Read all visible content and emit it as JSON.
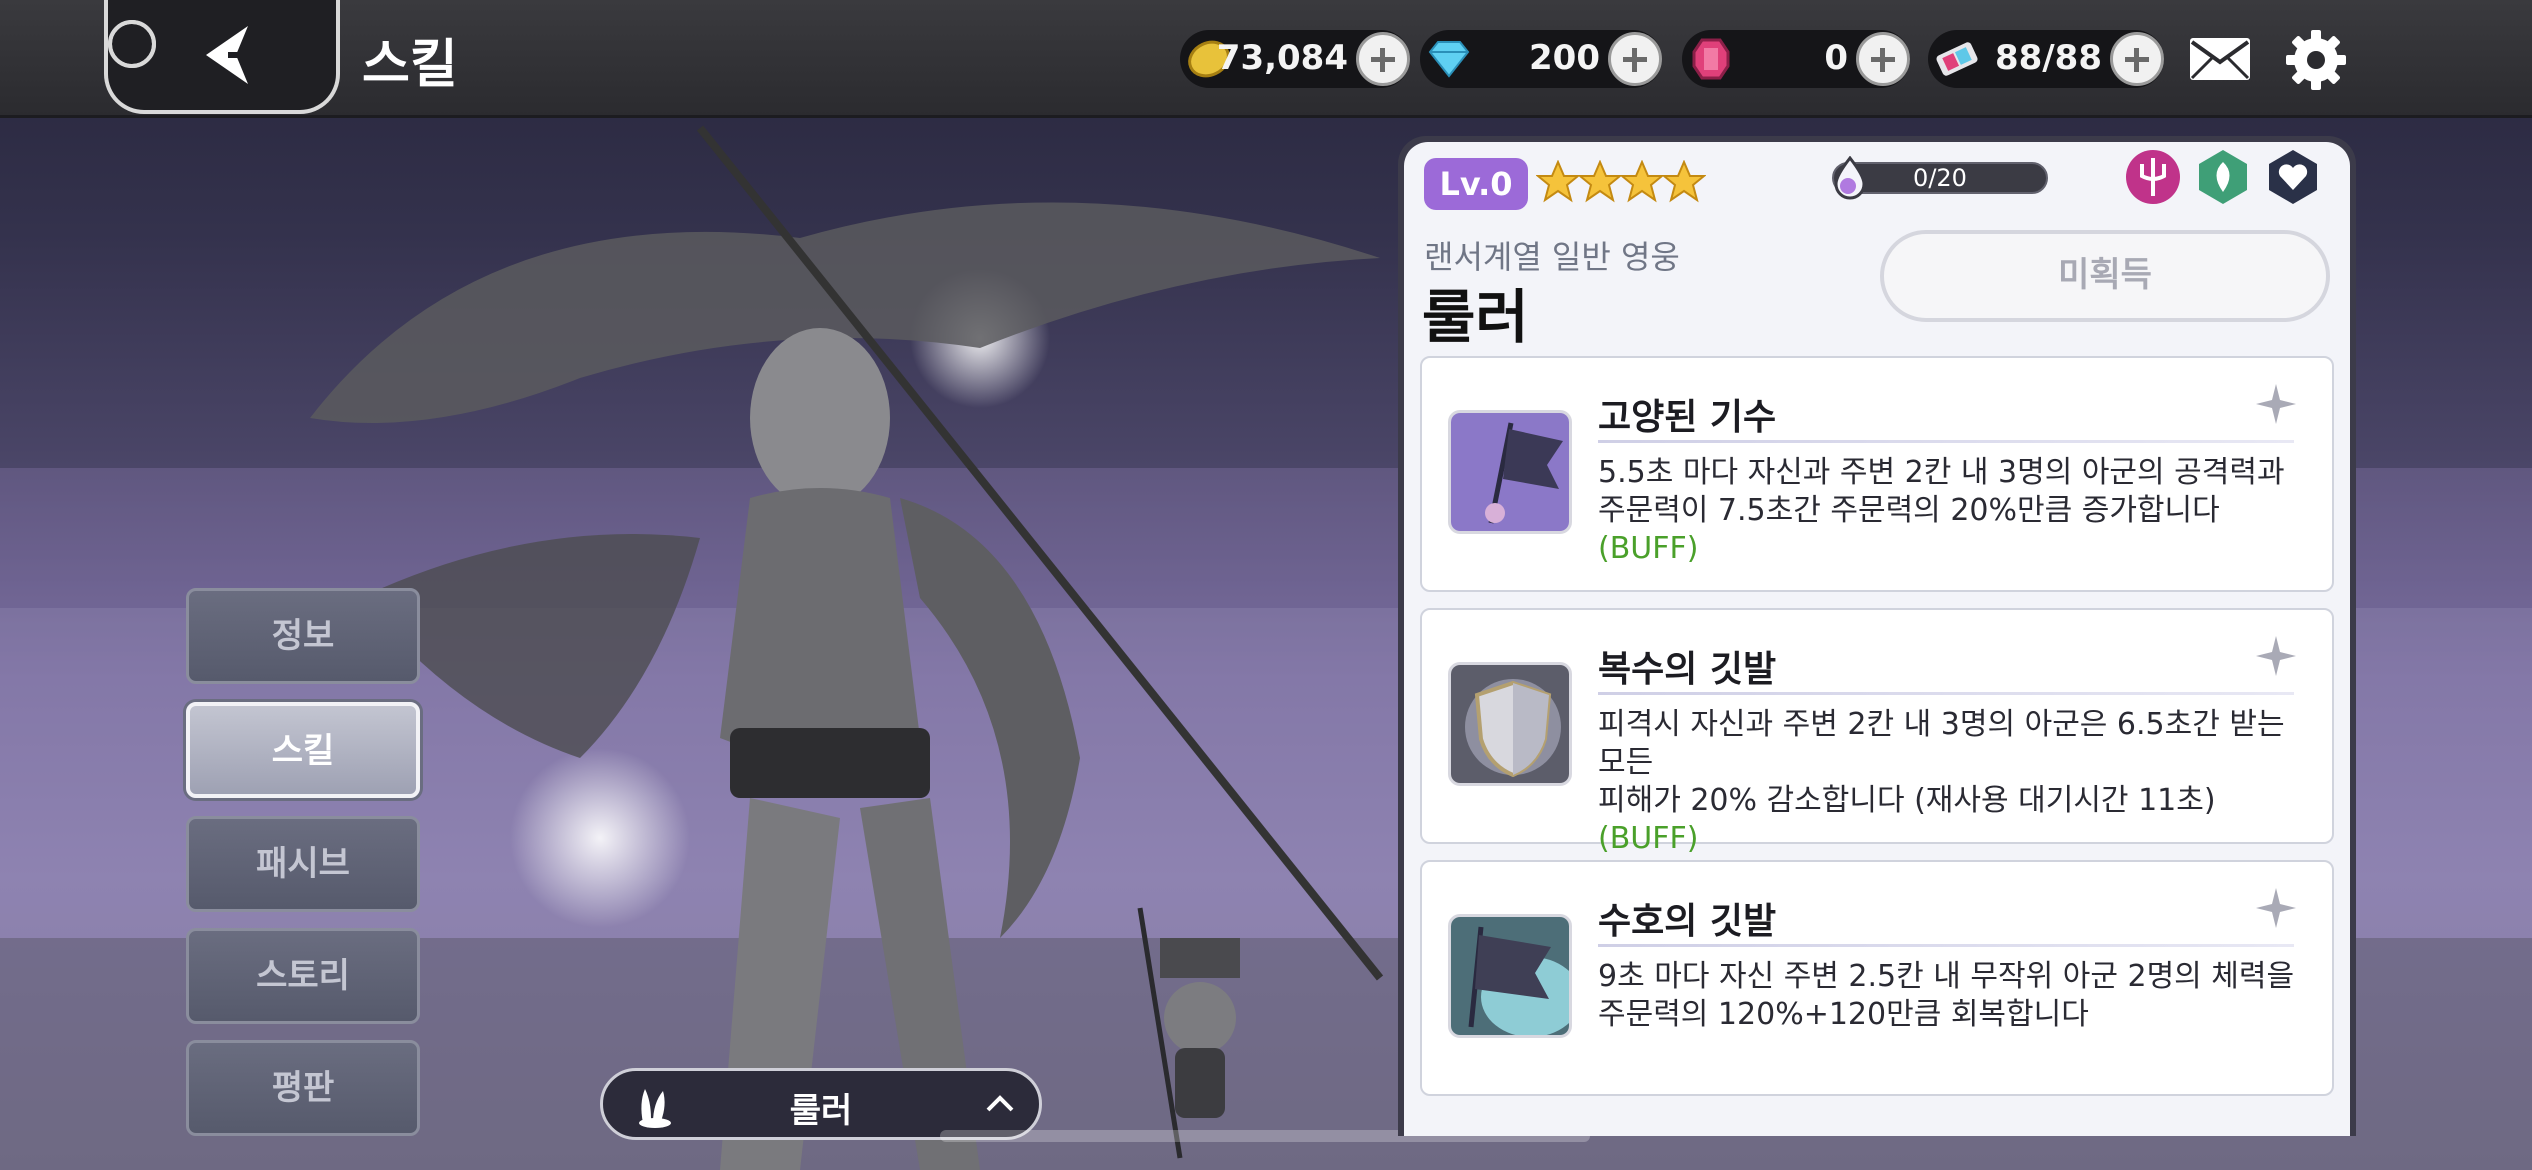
{
  "header": {
    "title": "스킬",
    "currencies": [
      {
        "icon": "gold-coin-icon",
        "value": "73,084"
      },
      {
        "icon": "diamond-icon",
        "value": "200"
      },
      {
        "icon": "ruby-gem-icon",
        "value": "0"
      },
      {
        "icon": "stamina-ticket-icon",
        "value": "88/88"
      }
    ]
  },
  "side_menu": [
    {
      "label": "정보",
      "active": false
    },
    {
      "label": "스킬",
      "active": true
    },
    {
      "label": "패시브",
      "active": false
    },
    {
      "label": "스토리",
      "active": false
    },
    {
      "label": "평판",
      "active": false
    }
  ],
  "hero_selector": {
    "name": "룰러"
  },
  "hero": {
    "level": "Lv.0",
    "stars": 4,
    "tier_progress": "0/20",
    "class_text": "랜서계열 일반 영웅",
    "name": "룰러",
    "acquire_label": "미획득",
    "attributes": [
      "trident-icon",
      "leaf-icon",
      "heart-icon"
    ]
  },
  "skills": [
    {
      "name": "고양된 기수",
      "desc_line1": "5.5초 마다 자신과 주변 2칸 내 3명의 아군의 공격력과",
      "desc_line2": "주문력이 7.5초간 주문력의 20%만큼 증가합니다",
      "tag": "(BUFF)",
      "icon": "raised-flag-icon"
    },
    {
      "name": "복수의 깃발",
      "desc_line1": "피격시 자신과 주변 2칸 내 3명의 아군은 6.5초간 받는 모든",
      "desc_line2": "피해가 20% 감소합니다 (재사용 대기시간 11초)",
      "tag": "(BUFF)",
      "icon": "shield-icon"
    },
    {
      "name": "수호의 깃발",
      "desc_line1": "9초 마다 자신 주변 2.5칸 내 무작위 아군 2명의 체력을",
      "desc_line2": "주문력의 120%+120만큼 회복합니다",
      "tag": "",
      "icon": "guardian-flag-icon"
    }
  ],
  "colors": {
    "level_badge": "#9c6ad8",
    "buff_text": "#4aa02a",
    "star": "#f5c33b"
  }
}
